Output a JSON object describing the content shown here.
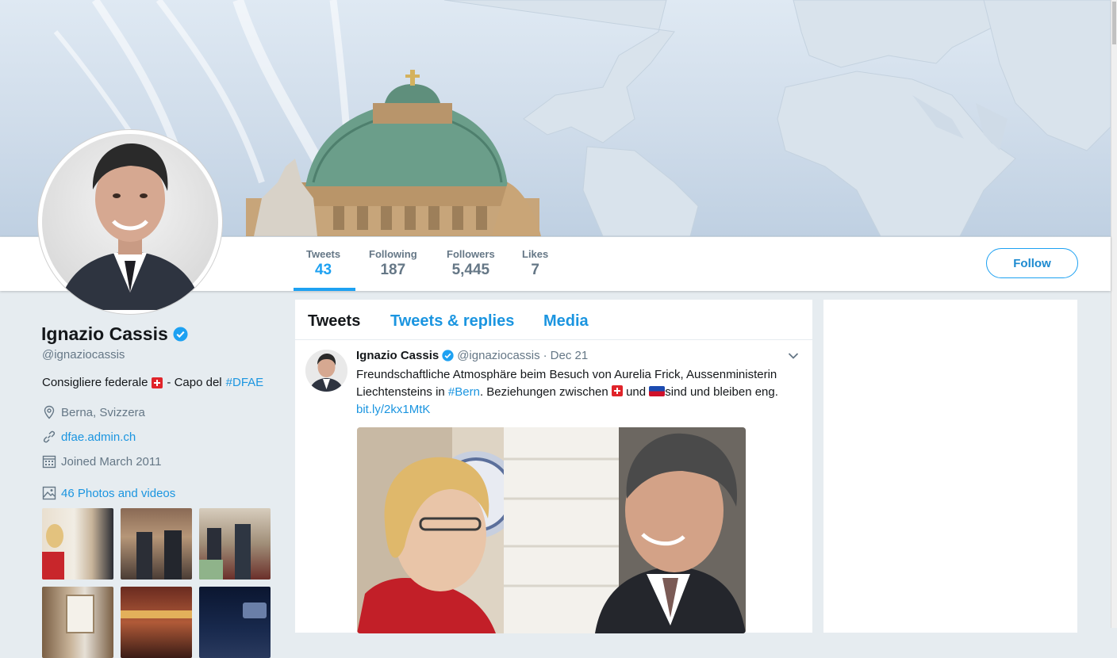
{
  "profile": {
    "name": "Ignazio Cassis",
    "handle": "@ignaziocassis",
    "bio_prefix": "Consigliere federale",
    "bio_middle": "- Capo del",
    "bio_hashtag": "#DFAE",
    "location": "Berna, Svizzera",
    "website": "dfae.admin.ch",
    "joined": "Joined March 2011",
    "photos_label": "46 Photos and videos"
  },
  "stats": [
    {
      "label": "Tweets",
      "value": "43"
    },
    {
      "label": "Following",
      "value": "187"
    },
    {
      "label": "Followers",
      "value": "5,445"
    },
    {
      "label": "Likes",
      "value": "7"
    }
  ],
  "follow_label": "Follow",
  "tabs": [
    {
      "label": "Tweets"
    },
    {
      "label": "Tweets & replies"
    },
    {
      "label": "Media"
    }
  ],
  "tweet": {
    "name": "Ignazio Cassis",
    "handle": "@ignaziocassis",
    "separator": "·",
    "date": "Dec 21",
    "line1": "Freundschaftliche Atmosphäre beim Besuch von Aurelia Frick, Aussenministerin",
    "line2_prefix": "Liechtensteins in",
    "line2_hashtag": "#Bern",
    "line2_middle": ". Beziehungen zwischen",
    "line2_und": "und",
    "line2_suffix": "sind und bleiben eng.",
    "link": "bit.ly/2kx1MtK"
  },
  "colors": {
    "accent": "#1da1f2",
    "link": "#1b95e0",
    "muted": "#657786",
    "background": "#e6ecf0"
  },
  "icons": [
    "verified-badge-icon",
    "location-icon",
    "link-icon",
    "calendar-icon",
    "photo-icon",
    "chevron-down-icon"
  ]
}
